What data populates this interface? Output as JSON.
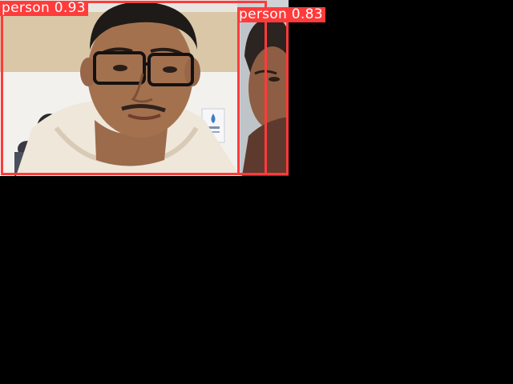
{
  "detections": [
    {
      "class_label": "person",
      "score_text": "0.93",
      "label": "person 0.93",
      "box_color": "#ff3b3b"
    },
    {
      "class_label": "person",
      "score_text": "0.83",
      "label": "person 0.83",
      "box_color": "#ff3b3b"
    }
  ],
  "colors": {
    "background": "#000000",
    "box": "#ff3b3b",
    "label_text": "#ffffff"
  }
}
